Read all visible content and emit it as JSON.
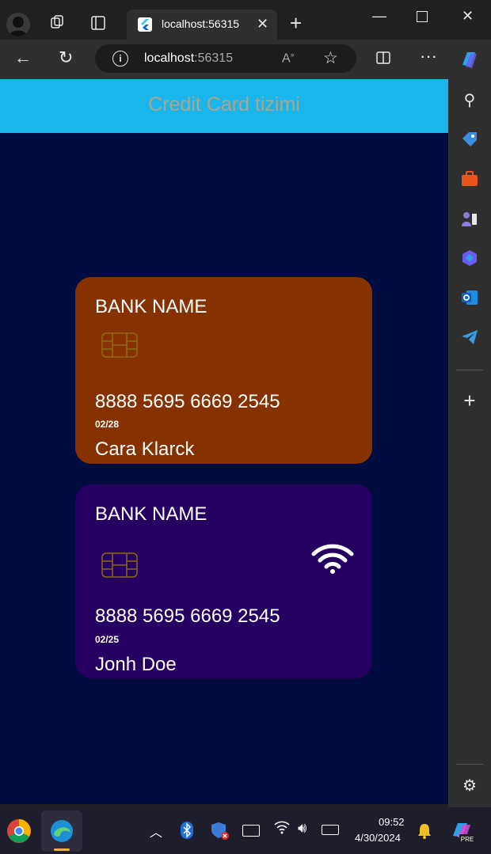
{
  "browser": {
    "tab_title": "localhost:56315",
    "address_host": "localhost",
    "address_port": ":56315"
  },
  "app": {
    "title": "Credit Card tizimi",
    "appbar_color": "#1ab5ea",
    "background_color": "#000c40"
  },
  "cards": [
    {
      "bank_name": "BANK NAME",
      "number": "8888 5695 6669 2545",
      "expiry": "02/28",
      "holder": "Cara Klarck",
      "color": "#853200",
      "contactless": false
    },
    {
      "bank_name": "BANK NAME",
      "number": "8888 5695 6669 2545",
      "expiry": "02/25",
      "holder": "Jonh Doe",
      "color": "#260060",
      "contactless": true
    }
  ],
  "taskbar": {
    "time": "09:52",
    "date": "4/30/2024"
  }
}
